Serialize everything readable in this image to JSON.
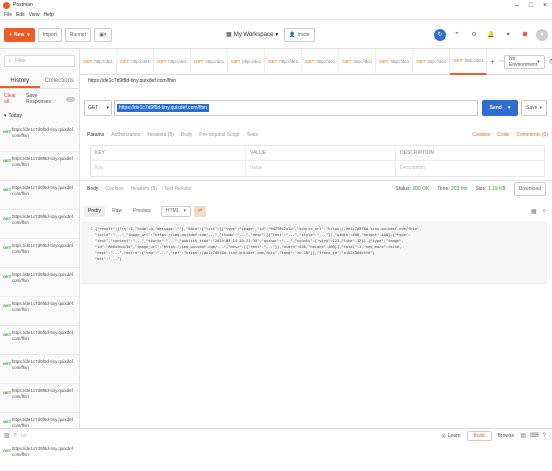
{
  "app": {
    "title": "Postman",
    "menu": [
      "File",
      "Edit",
      "View",
      "Help"
    ]
  },
  "header": {
    "new_label": "New",
    "import_label": "Import",
    "runner_label": "Runner",
    "workspace_label": "My Workspace",
    "invite_label": "Invite"
  },
  "sidebar": {
    "search_placeholder": "Filter",
    "tab_history": "History",
    "tab_collections": "Collections",
    "clear_all": "Clear all",
    "save_responses": "Save Responses",
    "group": "Today",
    "items": [
      {
        "method": "GET",
        "url": "https://de1c7d9f8d-tiny.quixdef.com/fhin"
      },
      {
        "method": "GET",
        "url": "https://de1c7d9f8d-tiny.quixdef.com/fhin"
      },
      {
        "method": "GET",
        "url": "https://de1c7d9f8d-tiny.quixdef.com/fhin"
      },
      {
        "method": "GET",
        "url": "https://de1c7d9f8d-tiny.quixdef.com/fhin"
      },
      {
        "method": "GET",
        "url": "https://de1c7d9f8d-tiny.quixdef.com/fhin"
      },
      {
        "method": "GET",
        "url": "https://de1c7d9f8d-tiny.quixdef.com/fhin"
      },
      {
        "method": "GET",
        "url": "https://de1c7d9f8d-tiny.quixdef.com/fhin"
      },
      {
        "method": "GET",
        "url": "https://de1c7d9f8d-tiny.quixdef.com/fhin"
      },
      {
        "method": "GET",
        "url": "https://de1c7d9f8d-tiny.quixdef.com/fhin"
      },
      {
        "method": "GET",
        "url": "https://de1c7d9f8d-tiny.quixdef.com/fhin"
      },
      {
        "method": "GET",
        "url": "https://de1c7d9f8d-tiny.quixdef.com/fhin"
      },
      {
        "method": "GET",
        "url": "https://de1c7d9f8d-tiny.quixdef.com/fhin"
      }
    ]
  },
  "tabs": [
    {
      "method": "GET",
      "label": "http://de1"
    },
    {
      "method": "GET",
      "label": "http://de1"
    },
    {
      "method": "GET",
      "label": "http://de1"
    },
    {
      "method": "GET",
      "label": "http://de1"
    },
    {
      "method": "GET",
      "label": "http://de1"
    },
    {
      "method": "GET",
      "label": "http://de1"
    },
    {
      "method": "GET",
      "label": "http://de1"
    },
    {
      "method": "GET",
      "label": "http://de1"
    },
    {
      "method": "GET",
      "label": "http://de1"
    },
    {
      "method": "GET",
      "label": "http://de1"
    },
    {
      "method": "GET",
      "label": "http://de1"
    }
  ],
  "environment": "No Environment",
  "request": {
    "title": "https://de1c7d9f8d-tiny.quixdef.com/fhin",
    "method": "GET",
    "url": "https://de1c7d9f8d-tiny.quixdef.com/fhin",
    "send_label": "Send",
    "save_label": "Save",
    "subtabs": [
      "Params",
      "Authorization",
      "Headers (8)",
      "Body",
      "Pre-request Script",
      "Tests"
    ],
    "right_links": [
      "Cookies",
      "Code",
      "Comments (0)"
    ],
    "params_header": {
      "key": "KEY",
      "value": "VALUE",
      "description": "DESCRIPTION"
    },
    "params_placeholder": {
      "key": "Key",
      "value": "Value",
      "description": "Description"
    }
  },
  "response": {
    "tabs": [
      "Body",
      "Cookies",
      "Headers (5)",
      "Test Results"
    ],
    "status_label": "Status:",
    "status_value": "200 OK",
    "time_label": "Time:",
    "time_value": "203 ms",
    "size_label": "Size:",
    "size_value": "1.19 KB",
    "download_label": "Download",
    "views": [
      "Pretty",
      "Raw",
      "Preview"
    ],
    "format": "HTML",
    "lines": [
      "{\"result\":{\"rs\":1,\"code\":0,\"message\":\"\"},\"data\":{\"list\":[{\"type\":\"image\",\"id\":\"9d7f8c2a1b\",\"source_url\":\"https://de1c7d9f8d-tiny.quixdef.com/fhin\",",
      "\"title\":\"...\",\"image_url\":\"https://img.quixdef.com/...\",\"thumb\":\"...\",\"desc\":[{\"text\":\"...\",\"style\":\"...\"}],\"width\":600,\"height\":400},{\"type\":",
      "\"text\",\"content\":\"...\",\"source\":\"...\",\"publish_time\":\"2019-02-14 10:21:35\",\"author\":\"...\",\"counts\":{\"view\":123,\"like\":12}},{\"type\":\"image\",",
      "\"id\":\"8e6a5b4c3d\",\"image_url\":\"https://img.quixdef.com/...\",\"desc\":[{\"text\":\"...\"}],\"width\":640,\"height\":480}],\"total\":3,\"has_more\":false,",
      "\"next\":\"...\",\"extra\":{\"tag\":\"...\",\"ref\":\"https://de1c7d9f8d-tiny.quixdef.com/fhin\",\"lang\":\"zh-CN\"}},\"trace_id\":\"a1b2c3d4e5f6\"}",
      "\"ext\":\"...\"}"
    ]
  },
  "bottom": {
    "learn": "Learn",
    "build": "Build",
    "browse": "Browse"
  }
}
